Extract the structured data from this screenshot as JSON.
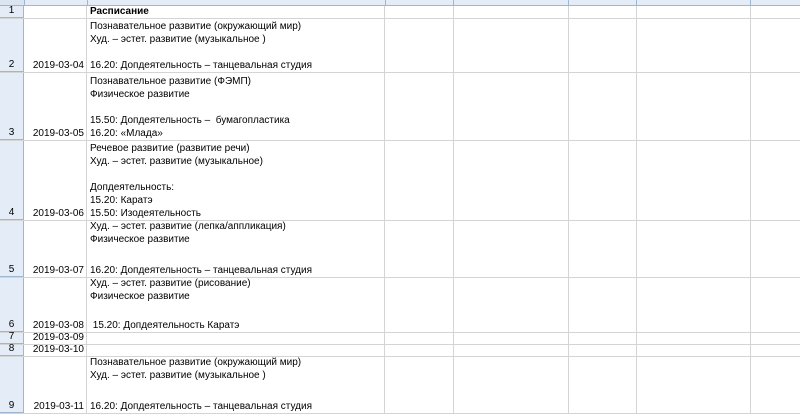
{
  "sheet": {
    "row1": {
      "num": "1",
      "b": "Расписание"
    },
    "rows": [
      {
        "num": "2",
        "date": "2019-03-04",
        "lines": [
          "Познавательное развитие (окружающий мир)",
          "Худ. – эстет. развитие (музыкальное )",
          "",
          "16.20: Допдеятельность – танцевальная студия"
        ]
      },
      {
        "num": "3",
        "date": "2019-03-05",
        "lines": [
          "Познавательное развитие (ФЭМП)",
          "Физическое развитие",
          "",
          "15.50: Допдеятельность –  бумагопластика",
          "16.20: «Млада»"
        ]
      },
      {
        "num": "4",
        "date": "2019-03-06",
        "lines": [
          "Речевое развитие (развитие речи)",
          "Худ. – эстет. развитие (музыкальное)",
          "",
          "Допдеятельность:",
          "15.20: Каратэ",
          "15.50: Изодеятельность"
        ]
      },
      {
        "num": "5",
        "date": "2019-03-07",
        "lines": [
          "Худ. – эстет. развитие (лепка/аппликация)",
          "Физическое развитие",
          "",
          "",
          "16.20: Допдеятельность – танцевальная студия"
        ]
      },
      {
        "num": "6",
        "date": "2019-03-08",
        "lines": [
          "Худ. – эстет. развитие (рисование)",
          "Физическое развитие",
          "",
          "",
          " 15.20: Допдеятельность Каратэ"
        ]
      },
      {
        "num": "7",
        "date": "2019-03-09",
        "lines": [
          ""
        ]
      },
      {
        "num": "8",
        "date": "2019-03-10",
        "lines": [
          ""
        ]
      },
      {
        "num": "9",
        "date": "2019-03-11",
        "lines": [
          "Познавательное развитие (окружающий мир)",
          "Худ. – эстет. развитие (музыкальное )",
          "",
          "",
          "16.20: Допдеятельность – танцевальная студия"
        ]
      }
    ]
  }
}
